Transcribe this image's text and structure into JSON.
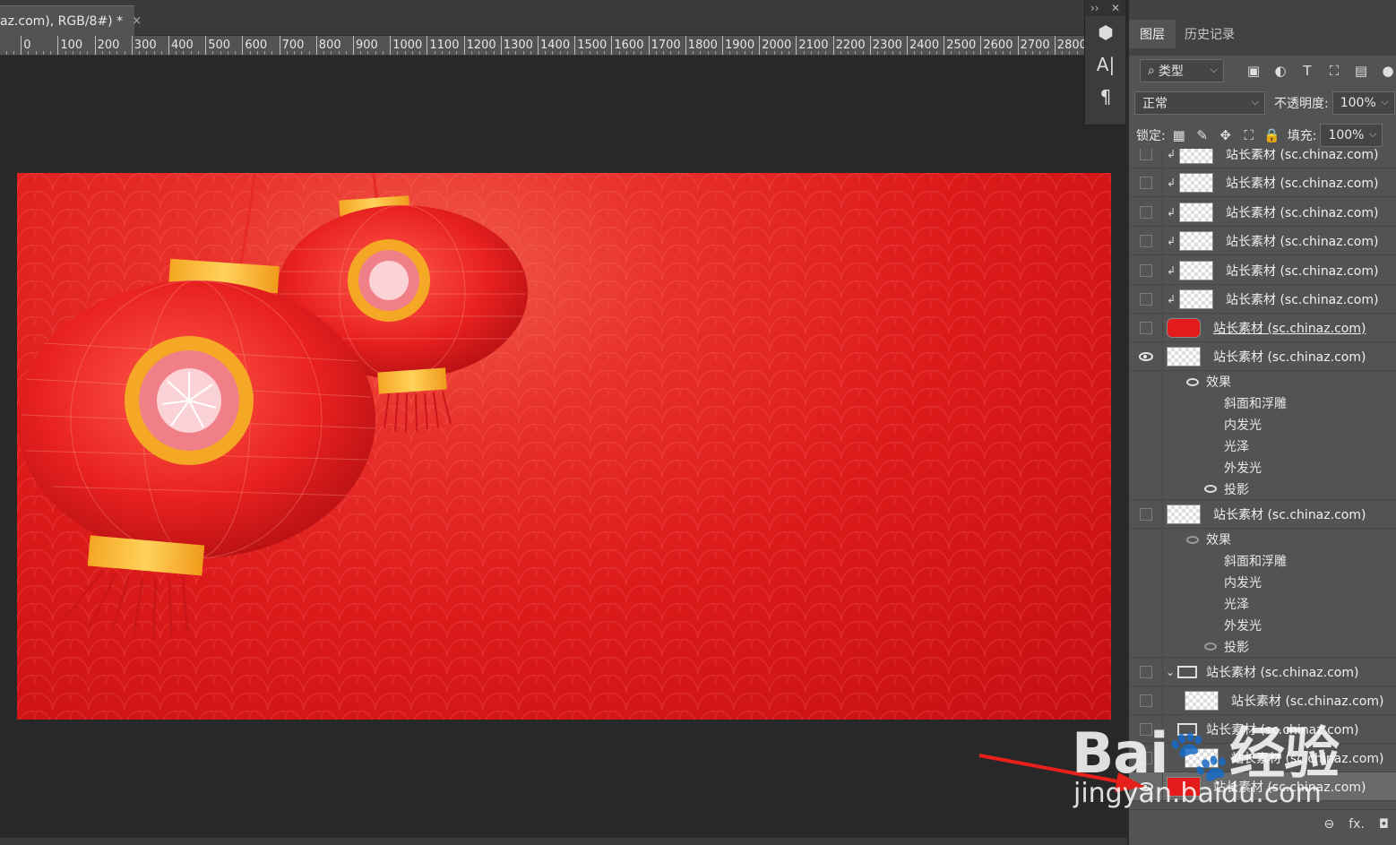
{
  "document_tab": {
    "title": "az.com), RGB/8#) *",
    "close": "×"
  },
  "ruler": {
    "ticks": [
      "0",
      "0",
      "100",
      "200",
      "300",
      "400",
      "500",
      "600",
      "700",
      "800",
      "900",
      "1000",
      "1100",
      "1200",
      "1300",
      "1400",
      "1500",
      "1600",
      "1700",
      "1800",
      "1900",
      "2000",
      "2100",
      "2200",
      "2300",
      "2400",
      "2500",
      "2600",
      "2700",
      "2800"
    ]
  },
  "toolstrip": {
    "expand": "››",
    "close": "✕",
    "tools": [
      "3d-icon",
      "character-icon",
      "paragraph-icon"
    ]
  },
  "panel": {
    "tabs": [
      "图层",
      "历史记录"
    ],
    "filter": {
      "label": "类型"
    },
    "blend_mode": "正常",
    "opacity_label": "不透明度:",
    "opacity_value": "100%",
    "lock_label": "锁定:",
    "fill_label": "填充:",
    "fill_value": "100%"
  },
  "layers": [
    {
      "name": "站长素材 (sc.chinaz.com)",
      "visible": false,
      "clip": true
    },
    {
      "name": "站长素材 (sc.chinaz.com)",
      "visible": false,
      "clip": true
    },
    {
      "name": "站长素材 (sc.chinaz.com)",
      "visible": false,
      "clip": true
    },
    {
      "name": "站长素材 (sc.chinaz.com)",
      "visible": false,
      "clip": true
    },
    {
      "name": "站长素材 (sc.chinaz.com)",
      "visible": false,
      "clip": true
    },
    {
      "name": "站长素材 (sc.chinaz.com)",
      "visible": false,
      "clip": true
    },
    {
      "name": "站长素材 (sc.chinaz.com)",
      "visible": false,
      "clip": false
    },
    {
      "name": "站长素材 (sc.chinaz.com)",
      "visible": true,
      "clip": false
    },
    {
      "name": "站长素材 (sc.chinaz.com)",
      "visible": false,
      "clip": false
    },
    {
      "name": "站长素材 (sc.chinaz.com)",
      "visible": false,
      "group": true
    },
    {
      "name": "站长素材 (sc.chinaz.com)",
      "visible": false,
      "clip": false
    },
    {
      "name": "站长素材 (sc.chinaz.com)",
      "visible": false,
      "group": true
    },
    {
      "name": "站长素材 (sc.chinaz.com)",
      "visible": false,
      "clip": false
    },
    {
      "name": "站长素材 (sc.chinaz.com)",
      "visible": true,
      "clip": false
    }
  ],
  "effects_a": {
    "title": "效果",
    "items": [
      "斜面和浮雕",
      "内发光",
      "光泽",
      "外发光",
      "投影"
    ]
  },
  "effects_b": {
    "title": "效果",
    "items": [
      "斜面和浮雕",
      "内发光",
      "光泽",
      "外发光",
      "投影"
    ]
  },
  "footer": {
    "link": "⊖",
    "fx": "fx.",
    "mask": "◘"
  },
  "watermark": {
    "brand": "Bai",
    "brand2": "经验",
    "url": "jingyan.baidu.com"
  },
  "colors": {
    "canvas_red": "#dc1a1a",
    "panel_bg": "#535353",
    "workspace": "#282828"
  }
}
